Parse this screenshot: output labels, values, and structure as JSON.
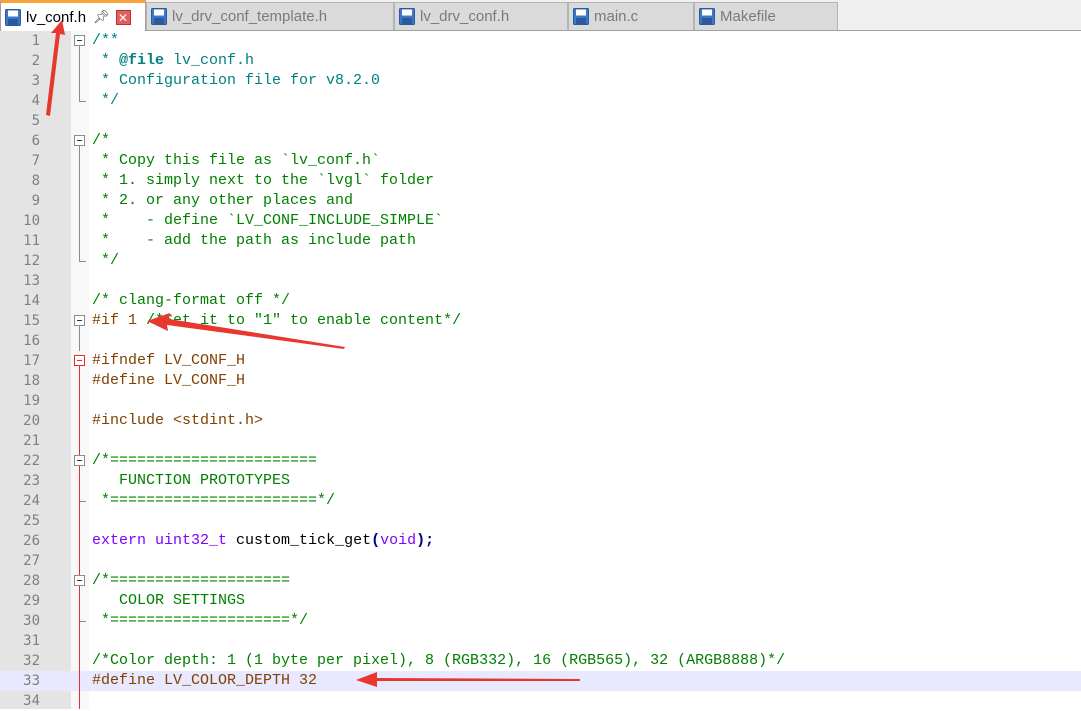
{
  "tabs": [
    {
      "label": "lv_conf.h",
      "active": true,
      "pinned": true,
      "closable": true
    },
    {
      "label": "lv_drv_conf_template.h",
      "active": false
    },
    {
      "label": "lv_drv_conf.h",
      "active": false
    },
    {
      "label": "main.c",
      "active": false
    },
    {
      "label": "Makefile",
      "active": false
    }
  ],
  "icons": {
    "pin": "pin-icon",
    "close": "close-icon",
    "file": "floppy-disk-icon"
  },
  "colors": {
    "accent_tab": "#f7a33b",
    "annotation_arrow": "#e8372c",
    "current_line": "#e8e8ff",
    "fold_highlight": "#e03030"
  },
  "editor": {
    "current_line": 33,
    "lines": [
      {
        "n": "1",
        "tokens": [
          {
            "t": "/**",
            "c": "doc"
          }
        ]
      },
      {
        "n": "2",
        "tokens": [
          {
            "t": " * ",
            "c": "doc"
          },
          {
            "t": "@file",
            "c": "doctag"
          },
          {
            "t": " lv_conf.h",
            "c": "doc"
          }
        ]
      },
      {
        "n": "3",
        "tokens": [
          {
            "t": " * Configuration file for v8.2.0",
            "c": "doc"
          }
        ]
      },
      {
        "n": "4",
        "tokens": [
          {
            "t": " */",
            "c": "doc"
          }
        ]
      },
      {
        "n": "5",
        "tokens": []
      },
      {
        "n": "6",
        "tokens": [
          {
            "t": "/*",
            "c": "comment"
          }
        ]
      },
      {
        "n": "7",
        "tokens": [
          {
            "t": " * Copy this file as `lv_conf.h`",
            "c": "comment"
          }
        ]
      },
      {
        "n": "8",
        "tokens": [
          {
            "t": " * 1. simply next to the `lvgl` folder",
            "c": "comment"
          }
        ]
      },
      {
        "n": "9",
        "tokens": [
          {
            "t": " * 2. or any other places and",
            "c": "comment"
          }
        ]
      },
      {
        "n": "10",
        "tokens": [
          {
            "t": " *    - define `LV_CONF_INCLUDE_SIMPLE`",
            "c": "comment"
          }
        ]
      },
      {
        "n": "11",
        "tokens": [
          {
            "t": " *    - add the path as include path",
            "c": "comment"
          }
        ]
      },
      {
        "n": "12",
        "tokens": [
          {
            "t": " */",
            "c": "comment"
          }
        ]
      },
      {
        "n": "13",
        "tokens": []
      },
      {
        "n": "14",
        "tokens": [
          {
            "t": "/* clang-format off */",
            "c": "comment"
          }
        ]
      },
      {
        "n": "15",
        "tokens": [
          {
            "t": "#if 1 ",
            "c": "pre"
          },
          {
            "t": "/*Set it to \"1\" to enable content*/",
            "c": "comment"
          }
        ]
      },
      {
        "n": "16",
        "tokens": []
      },
      {
        "n": "17",
        "tokens": [
          {
            "t": "#ifndef LV_CONF_H",
            "c": "pre"
          }
        ]
      },
      {
        "n": "18",
        "tokens": [
          {
            "t": "#define LV_CONF_H",
            "c": "pre"
          }
        ]
      },
      {
        "n": "19",
        "tokens": []
      },
      {
        "n": "20",
        "tokens": [
          {
            "t": "#include <stdint.h>",
            "c": "pre"
          }
        ]
      },
      {
        "n": "21",
        "tokens": []
      },
      {
        "n": "22",
        "tokens": [
          {
            "t": "/*=======================",
            "c": "comment"
          }
        ]
      },
      {
        "n": "23",
        "tokens": [
          {
            "t": "   FUNCTION PROTOTYPES",
            "c": "comment"
          }
        ]
      },
      {
        "n": "24",
        "tokens": [
          {
            "t": " *=======================*/",
            "c": "comment"
          }
        ]
      },
      {
        "n": "25",
        "tokens": []
      },
      {
        "n": "26",
        "tokens": [
          {
            "t": "extern",
            "c": "kw"
          },
          {
            "t": " ",
            "c": "plain"
          },
          {
            "t": "uint32_t",
            "c": "type"
          },
          {
            "t": " custom_tick_get",
            "c": "plain"
          },
          {
            "t": "(",
            "c": "op"
          },
          {
            "t": "void",
            "c": "kw"
          },
          {
            "t": ");",
            "c": "op"
          }
        ]
      },
      {
        "n": "27",
        "tokens": []
      },
      {
        "n": "28",
        "tokens": [
          {
            "t": "/*====================",
            "c": "comment"
          }
        ]
      },
      {
        "n": "29",
        "tokens": [
          {
            "t": "   COLOR SETTINGS",
            "c": "comment"
          }
        ]
      },
      {
        "n": "30",
        "tokens": [
          {
            "t": " *====================*/",
            "c": "comment"
          }
        ]
      },
      {
        "n": "31",
        "tokens": []
      },
      {
        "n": "32",
        "tokens": [
          {
            "t": "/*Color depth: 1 (1 byte per pixel), 8 (RGB332), 16 (RGB565), 32 (ARGB8888)*/",
            "c": "comment"
          }
        ]
      },
      {
        "n": "33",
        "tokens": [
          {
            "t": "#define LV_COLOR_DEPTH 32",
            "c": "pre"
          }
        ]
      },
      {
        "n": "34",
        "tokens": []
      }
    ]
  }
}
